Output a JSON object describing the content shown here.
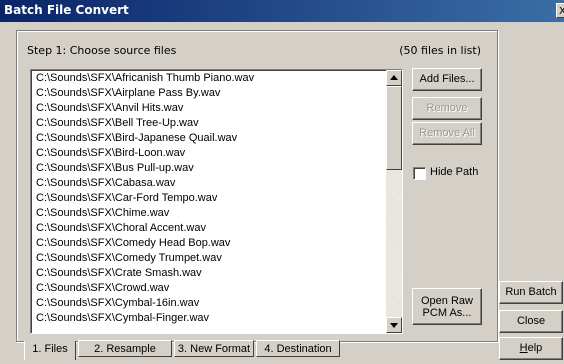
{
  "window": {
    "title": "Batch File Convert",
    "close_glyph": "X"
  },
  "step": {
    "label": "Step 1:  Choose source files",
    "count": "(50 files in list)"
  },
  "files": [
    "C:\\Sounds\\SFX\\Africanish Thumb Piano.wav",
    "C:\\Sounds\\SFX\\Airplane Pass By.wav",
    "C:\\Sounds\\SFX\\Anvil Hits.wav",
    "C:\\Sounds\\SFX\\Bell Tree-Up.wav",
    "C:\\Sounds\\SFX\\Bird-Japanese Quail.wav",
    "C:\\Sounds\\SFX\\Bird-Loon.wav",
    "C:\\Sounds\\SFX\\Bus Pull-up.wav",
    "C:\\Sounds\\SFX\\Cabasa.wav",
    "C:\\Sounds\\SFX\\Car-Ford Tempo.wav",
    "C:\\Sounds\\SFX\\Chime.wav",
    "C:\\Sounds\\SFX\\Choral Accent.wav",
    "C:\\Sounds\\SFX\\Comedy Head Bop.wav",
    "C:\\Sounds\\SFX\\Comedy Trumpet.wav",
    "C:\\Sounds\\SFX\\Crate Smash.wav",
    "C:\\Sounds\\SFX\\Crowd.wav",
    "C:\\Sounds\\SFX\\Cymbal-16in.wav",
    "C:\\Sounds\\SFX\\Cymbal-Finger.wav"
  ],
  "buttons": {
    "add_files": "Add Files...",
    "remove": "Remove",
    "remove_all": "Remove All",
    "open_raw_line1": "Open Raw",
    "open_raw_line2": "PCM As...",
    "run_batch": "Run Batch",
    "close": "Close",
    "help_first": "H",
    "help_rest": "elp"
  },
  "hide_path": {
    "label": "Hide Path",
    "checked": false
  },
  "tabs": [
    "1. Files",
    "2. Resample",
    "3. New Format",
    "4. Destination"
  ],
  "active_tab": 0
}
